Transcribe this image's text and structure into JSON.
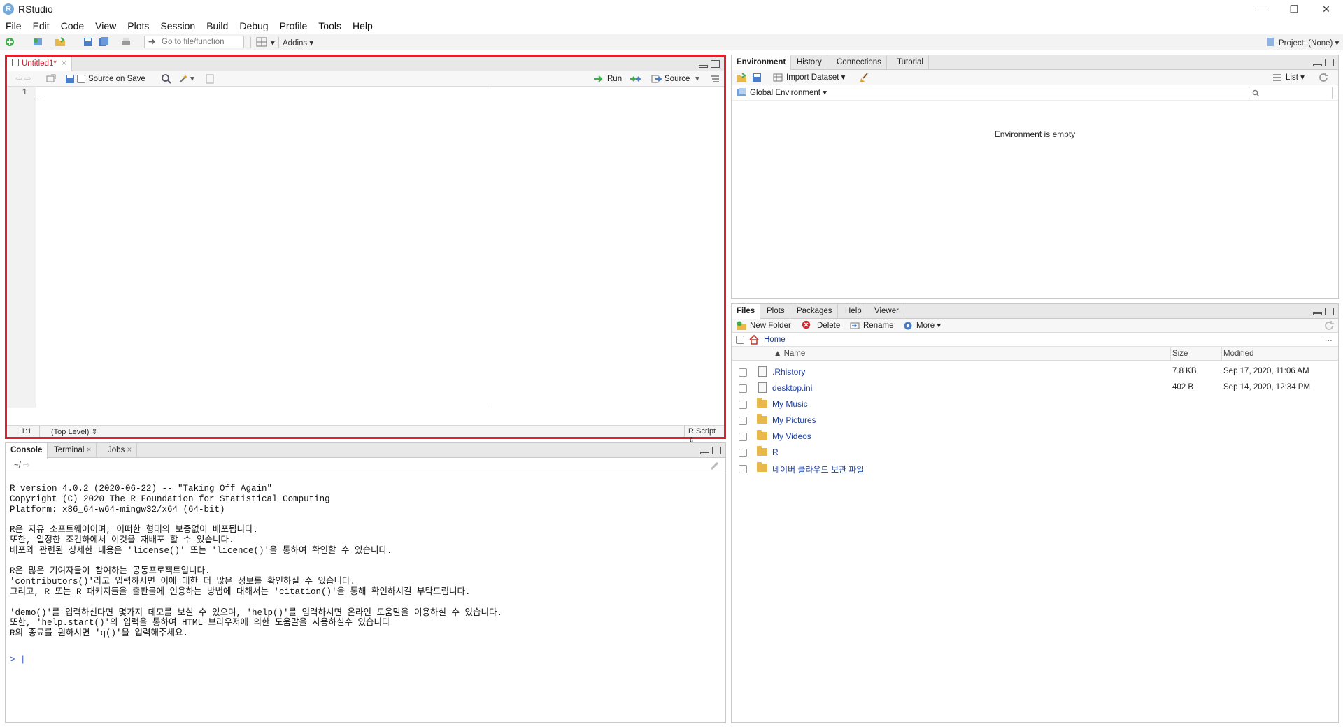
{
  "window": {
    "title": "RStudio"
  },
  "menu": [
    "File",
    "Edit",
    "Code",
    "View",
    "Plots",
    "Session",
    "Build",
    "Debug",
    "Profile",
    "Tools",
    "Help"
  ],
  "toolbar": {
    "goto_placeholder": "Go to file/function",
    "addins_label": "Addins",
    "project_label": "Project: (None)"
  },
  "editor": {
    "tab_label": "Untitled1*",
    "source_on_save_label": "Source on Save",
    "run_label": "Run",
    "source_label": "Source",
    "line_number": "1",
    "cursor_pos": "1:1",
    "scope": "(Top Level)",
    "file_type": "R Script"
  },
  "console": {
    "tabs": [
      "Console",
      "Terminal",
      "Jobs"
    ],
    "path": "~/",
    "lines": [
      "R version 4.0.2 (2020-06-22) -- \"Taking Off Again\"",
      "Copyright (C) 2020 The R Foundation for Statistical Computing",
      "Platform: x86_64-w64-mingw32/x64 (64-bit)",
      "",
      "R은 자유 소프트웨어이며, 어떠한 형태의 보증없이 배포됩니다.",
      "또한, 일정한 조건하에서 이것을 재배포 할 수 있습니다.",
      "배포와 관련된 상세한 내용은 'license()' 또는 'licence()'을 통하여 확인할 수 있습니다.",
      "",
      "R은 많은 기여자들이 참여하는 공동프로젝트입니다.",
      "'contributors()'라고 입력하시면 이에 대한 더 많은 정보를 확인하실 수 있습니다.",
      "그리고, R 또는 R 패키지들을 출판물에 인용하는 방법에 대해서는 'citation()'을 통해 확인하시길 부탁드립니다.",
      "",
      "'demo()'를 입력하신다면 몇가지 데모를 보실 수 있으며, 'help()'를 입력하시면 온라인 도움말을 이용하실 수 있습니다.",
      "또한, 'help.start()'의 입력을 통하여 HTML 브라우저에 의한 도움말을 사용하실수 있습니다",
      "R의 종료를 원하시면 'q()'을 입력해주세요.",
      "",
      ""
    ],
    "prompt": ">"
  },
  "environment": {
    "tabs": [
      "Environment",
      "History",
      "Connections",
      "Tutorial"
    ],
    "import_label": "Import Dataset",
    "list_label": "List",
    "scope_label": "Global Environment",
    "empty_message": "Environment is empty"
  },
  "files": {
    "tabs": [
      "Files",
      "Plots",
      "Packages",
      "Help",
      "Viewer"
    ],
    "new_folder_label": "New Folder",
    "delete_label": "Delete",
    "rename_label": "Rename",
    "more_label": "More",
    "breadcrumb": "Home",
    "columns": [
      "Name",
      "Size",
      "Modified"
    ],
    "rows": [
      {
        "name": ".Rhistory",
        "size": "7.8 KB",
        "modified": "Sep 17, 2020, 11:06 AM",
        "kind": "file"
      },
      {
        "name": "desktop.ini",
        "size": "402 B",
        "modified": "Sep 14, 2020, 12:34 PM",
        "kind": "file"
      },
      {
        "name": "My Music",
        "size": "",
        "modified": "",
        "kind": "folder"
      },
      {
        "name": "My Pictures",
        "size": "",
        "modified": "",
        "kind": "folder"
      },
      {
        "name": "My Videos",
        "size": "",
        "modified": "",
        "kind": "folder"
      },
      {
        "name": "R",
        "size": "",
        "modified": "",
        "kind": "folder"
      },
      {
        "name": "네이버 클라우드 보관 파일",
        "size": "",
        "modified": "",
        "kind": "folder"
      }
    ]
  },
  "colors": {
    "highlight_border": "#e0202a",
    "link": "#1b3fa0",
    "r_blue": "#75aadb"
  }
}
